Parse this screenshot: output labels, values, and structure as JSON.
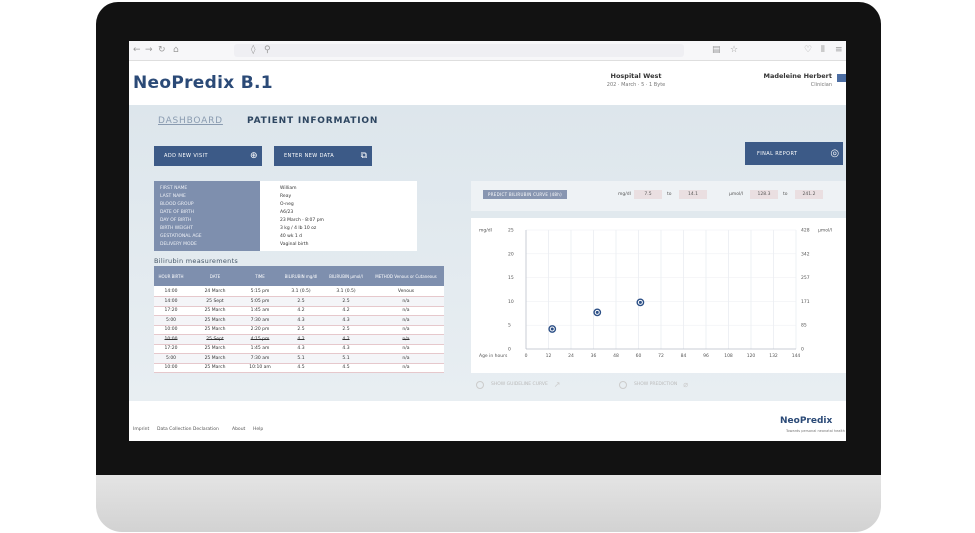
{
  "app": {
    "logo_primary": "NeoPredix",
    "logo_version": "B.1",
    "hospital_name": "Hospital West",
    "hospital_detail": "202 · March · 5 · 1 Byte",
    "user_name": "Madeleine Herbert",
    "user_role": "Clinician"
  },
  "tabs": {
    "dashboard": "DASHBOARD",
    "patient_information": "PATIENT INFORMATION"
  },
  "buttons": {
    "add_new_visit": "ADD NEW VISIT",
    "enter_new_data": "ENTER NEW DATA",
    "final_report": "FINAL REPORT"
  },
  "patient_info": [
    {
      "label": "FIRST NAME",
      "value": "William"
    },
    {
      "label": "LAST NAME",
      "value": "Reay"
    },
    {
      "label": "BLOOD GROUP",
      "value": "O-neg"
    },
    {
      "label": "DATE OF BIRTH",
      "value": "A6/23"
    },
    {
      "label": "DAY OF BIRTH",
      "value": "23 March · 8:07 pm"
    },
    {
      "label": "BIRTH WEIGHT",
      "value": "3 kg / 4 lb 10 oz"
    },
    {
      "label": "GESTATIONAL AGE",
      "value": "40 wk 1 d"
    },
    {
      "label": "DELIVERY MODE",
      "value": "Vaginal birth"
    }
  ],
  "measurements": {
    "title": "Bilirubin measurements",
    "headers": [
      "HOUR BIRTH",
      "DATE",
      "TIME",
      "BILIRUBIN mg/dl",
      "BILIRUBIN µmol/l",
      "METHOD Venous or Cutaneous"
    ],
    "rows": [
      {
        "hour": "14:00",
        "date": "24 March",
        "time": "5:15 pm",
        "mgdl": "3.1 (0.5)",
        "umol": "3.1 (0.5)",
        "method": "Venous"
      },
      {
        "hour": "14:00",
        "date": "25 Sept",
        "time": "5:05 pm",
        "mgdl": "2.5",
        "umol": "2.5",
        "method": "n/a"
      },
      {
        "hour": "17:20",
        "date": "25 March",
        "time": "1:45 am",
        "mgdl": "4.2",
        "umol": "4.2",
        "method": "n/a"
      },
      {
        "hour": "5:00",
        "date": "25 March",
        "time": "7:30 am",
        "mgdl": "4.3",
        "umol": "4.3",
        "method": "n/a"
      },
      {
        "hour": "10:00",
        "date": "25 March",
        "time": "2:20 pm",
        "mgdl": "2.5",
        "umol": "2.5",
        "method": "n/a"
      },
      {
        "hour": "10:00",
        "date": "25 Sept",
        "time": "4:15 pm",
        "mgdl": "4.2",
        "umol": "4.2",
        "method": "n/a"
      },
      {
        "hour": "17:20",
        "date": "25 March",
        "time": "1:45 am",
        "mgdl": "4.3",
        "umol": "4.3",
        "method": "n/a"
      },
      {
        "hour": "5:00",
        "date": "25 March",
        "time": "7:30 am",
        "mgdl": "5.1",
        "umol": "5.1",
        "method": "n/a"
      },
      {
        "hour": "10:00",
        "date": "25 March",
        "time": "10:10 am",
        "mgdl": "4.5",
        "umol": "4.5",
        "method": "n/a"
      }
    ]
  },
  "chart_panel": {
    "predict_label": "PREDICT BILIRUBIN CURVE (48h)",
    "unit_mgdl": "mg/dl",
    "mgdl_from": "7.5",
    "mgdl_to": "14.1",
    "unit_umol": "µmol/l",
    "umol_from": "128.3",
    "umol_to": "241.2",
    "to": "to",
    "toggle_1": "SHOW GUIDELINE CURVE",
    "toggle_2": "SHOW PREDICTION"
  },
  "chart_data": {
    "type": "scatter",
    "ylabel_left": "mg/dl",
    "ylabel_right": "µmol/l",
    "xlabel": "Age in hours",
    "x_ticks": [
      0,
      12,
      24,
      36,
      48,
      60,
      72,
      84,
      96,
      108,
      120,
      132,
      144
    ],
    "y_left_ticks": [
      0,
      5,
      10,
      15,
      20,
      25
    ],
    "y_right_ticks": [
      0,
      85,
      171,
      257,
      342,
      428
    ],
    "xlim": [
      0,
      144
    ],
    "ylim": [
      0,
      25
    ],
    "points": [
      {
        "x": 14,
        "y": 4.2
      },
      {
        "x": 38,
        "y": 7.7
      },
      {
        "x": 61,
        "y": 9.8
      }
    ],
    "grid": true,
    "marker_color": "#2c4f86"
  },
  "footer": {
    "links": [
      "Imprint",
      "Data Collection Declaration",
      "About",
      "Help"
    ],
    "logo": "NeoPredix",
    "tagline": "Towards personal neonatal health"
  }
}
